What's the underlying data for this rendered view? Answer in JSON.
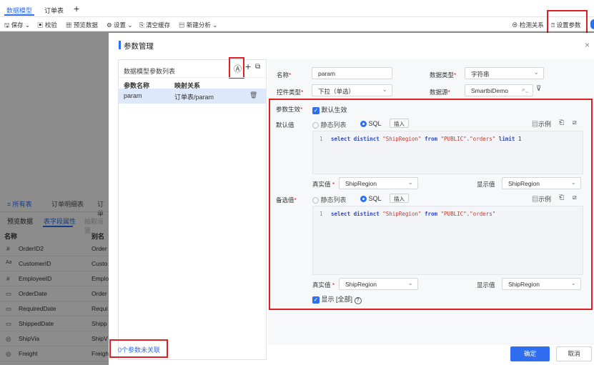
{
  "tabs": [
    {
      "label": "数据模型"
    },
    {
      "label": "订单表"
    },
    {
      "label": "+"
    }
  ],
  "toolbar": {
    "save": "保存",
    "verify": "校验",
    "preview": "预览数据",
    "settings": "设置",
    "clear": "清空缓存",
    "new_analysis": "新建分析",
    "detect": "检测关系",
    "set_params": "设置参数"
  },
  "bg": {
    "tabs": [
      "所有表",
      "订单明细表",
      "订单"
    ],
    "subtabs": [
      "预览数据",
      "表字段属性",
      "抽取设置"
    ],
    "cols": [
      "名称",
      "别名"
    ],
    "rows": [
      {
        "icon": "#",
        "name": "OrderID2",
        "alias": "Order"
      },
      {
        "icon": "Aa",
        "name": "CustomerID",
        "alias": "Custo"
      },
      {
        "icon": "#",
        "name": "EmployeeID",
        "alias": "Emplo"
      },
      {
        "icon": "cal",
        "name": "OrderDate",
        "alias": "Order"
      },
      {
        "icon": "cal",
        "name": "RequiredDate",
        "alias": "Requi"
      },
      {
        "icon": "cal",
        "name": "ShippedDate",
        "alias": "Shipp"
      },
      {
        "icon": "eye",
        "name": "ShipVia",
        "alias": "ShipV"
      },
      {
        "icon": "eye",
        "name": "Freight",
        "alias": "Freigh"
      }
    ]
  },
  "dialog": {
    "title": "参数管理",
    "list_title": "数据模型参数列表",
    "col_name": "参数名称",
    "col_map": "映射关系",
    "param": {
      "name": "param",
      "map": "订单表/param"
    },
    "unlinked": "0个参数未关联",
    "form": {
      "name_label": "名称",
      "name_value": "param",
      "type_label": "数据类型",
      "type_value": "字符串",
      "control_label": "控件类型",
      "control_value": "下拉（单选）",
      "source_label": "数据源",
      "source_value": "SmartbiDemo",
      "effect_label": "参数生效",
      "effect_check": "默认生效",
      "default_label": "默认值",
      "static": "静态列表",
      "sql": "SQL",
      "insert": "插入",
      "example": "示例",
      "sql1": {
        "line": "1",
        "kw1": "select distinct ",
        "s1": "\"ShipRegion\"",
        "kw2": " from ",
        "s2": "\"PUBLIC\"",
        "dot": ".",
        "s3": "\"orders\"",
        "kw3": " limit ",
        "num": "1"
      },
      "real_label": "真实值",
      "real_value": "ShipRegion",
      "disp_label": "显示值",
      "disp_value": "ShipRegion",
      "cand_label": "备选值",
      "sql2": {
        "line": "1",
        "kw1": "select distinct ",
        "s1": "\"ShipRegion\"",
        "kw2": " from ",
        "s2": "\"PUBLIC\"",
        "dot": ".",
        "s3": "\"orders\""
      },
      "show_all": "显示 [全部]"
    },
    "ok": "确定",
    "cancel": "取消"
  },
  "colors": {
    "accent": "#2f6ef0",
    "highlight": "#e02020"
  }
}
